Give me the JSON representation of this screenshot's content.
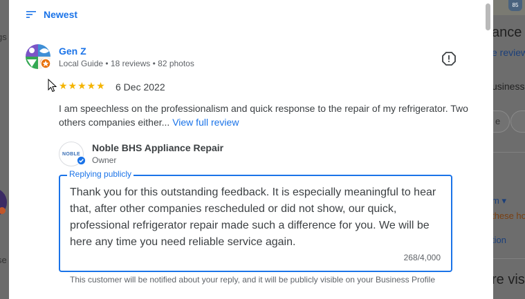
{
  "colors": {
    "accent": "#1a73e8",
    "star": "#f4b400",
    "text": "#3c4043",
    "muted": "#5f6368"
  },
  "sort": {
    "label": "Newest",
    "icon": "sort-icon"
  },
  "review": {
    "reviewer_name": "Gen Z",
    "reviewer_meta": "Local Guide • 18 reviews • 82 photos",
    "rating": 5,
    "stars": "★★★★★",
    "date": "6 Dec 2022",
    "text": "I am speechless on the professionalism and quick response to the repair of my refrigerator. Two others companies either...",
    "more_link": "View full review",
    "report_icon": "report-icon"
  },
  "owner": {
    "avatar_text": "NOBLE",
    "name": "Noble BHS Appliance Repair",
    "role": "Owner"
  },
  "reply": {
    "label": "Replying publicly",
    "text": "Thank you for this outstanding feedback. It is especially meaningful to hear that, after other companies rescheduled or did not show, our quick, professional refrigerator repair made such a difference for you. We will be here any time you need reliable service again.",
    "char_count": "268/4,000",
    "notice": "This customer will be notified about your reply, and it will be publicly visible on your Business Profile"
  },
  "background": {
    "left_fragment_1": "gs",
    "left_fragment_2": "se",
    "right_title_fragment": "ance",
    "right_reviews_fragment": "e review",
    "right_business_fragment": "usiness",
    "right_button_fragment": "e",
    "right_dropdown_fragment": "m ▾",
    "right_orange_fragment": "these ho",
    "right_link_fragment": "tion",
    "right_bottom_fragment": "re visi",
    "map_shield": "85"
  }
}
